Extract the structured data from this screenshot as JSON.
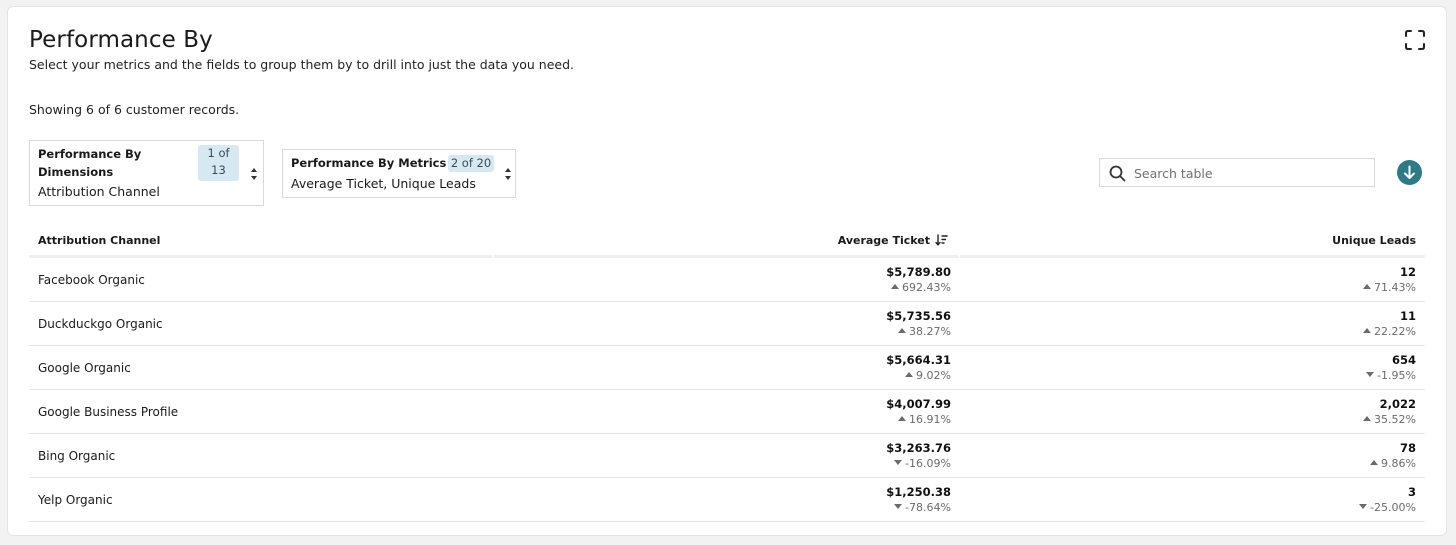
{
  "header": {
    "title": "Performance By",
    "subtitle": "Select your metrics and the fields to group them by to drill into just the data you need.",
    "records_text": "Showing 6 of 6 customer records."
  },
  "dimensions_select": {
    "label": "Performance By Dimensions",
    "label_line1": "Performance By",
    "label_line2": "Dimensions",
    "badge_line1": "1 of",
    "badge_line2": "13",
    "value": "Attribution Channel"
  },
  "metrics_select": {
    "label": "Performance By Metrics",
    "badge": "2 of 20",
    "value": "Average Ticket, Unique Leads"
  },
  "search": {
    "placeholder": "Search table",
    "value": ""
  },
  "table": {
    "columns": [
      "Attribution Channel",
      "Average Ticket",
      "Unique Leads"
    ],
    "sorted_column": "Average Ticket",
    "rows": [
      {
        "channel": "Facebook Organic",
        "avg_ticket": "$5,789.80",
        "avg_ticket_change": "692.43%",
        "avg_ticket_dir": "up",
        "leads": "12",
        "leads_change": "71.43%",
        "leads_dir": "up"
      },
      {
        "channel": "Duckduckgo Organic",
        "avg_ticket": "$5,735.56",
        "avg_ticket_change": "38.27%",
        "avg_ticket_dir": "up",
        "leads": "11",
        "leads_change": "22.22%",
        "leads_dir": "up"
      },
      {
        "channel": "Google Organic",
        "avg_ticket": "$5,664.31",
        "avg_ticket_change": "9.02%",
        "avg_ticket_dir": "up",
        "leads": "654",
        "leads_change": "-1.95%",
        "leads_dir": "down"
      },
      {
        "channel": "Google Business Profile",
        "avg_ticket": "$4,007.99",
        "avg_ticket_change": "16.91%",
        "avg_ticket_dir": "up",
        "leads": "2,022",
        "leads_change": "35.52%",
        "leads_dir": "up"
      },
      {
        "channel": "Bing Organic",
        "avg_ticket": "$3,263.76",
        "avg_ticket_change": "-16.09%",
        "avg_ticket_dir": "down",
        "leads": "78",
        "leads_change": "9.86%",
        "leads_dir": "up"
      },
      {
        "channel": "Yelp Organic",
        "avg_ticket": "$1,250.38",
        "avg_ticket_change": "-78.64%",
        "avg_ticket_dir": "down",
        "leads": "3",
        "leads_change": "-25.00%",
        "leads_dir": "down"
      }
    ]
  },
  "icons": {
    "expand": "expand-icon",
    "search": "search-icon",
    "download": "download-icon",
    "sort": "sort-descending-icon",
    "caret": "select-caret-icon"
  },
  "colors": {
    "accent": "#2e7b86",
    "badge_bg": "#d6e9f3",
    "muted_text": "#6b6b6b"
  }
}
